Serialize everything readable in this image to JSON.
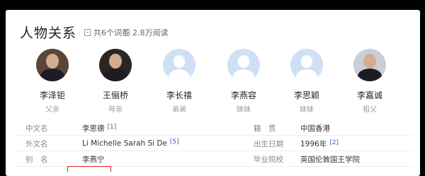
{
  "section": {
    "title": "人物关系",
    "term_count": "共6个词条",
    "read_count": "2.8万阅读"
  },
  "people": [
    {
      "name": "李泽钜",
      "relation": "父亲",
      "avatar": "photo"
    },
    {
      "name": "王俪桥",
      "relation": "母亲",
      "avatar": "photo"
    },
    {
      "name": "李长禧",
      "relation": "弟弟",
      "avatar": "placeholder"
    },
    {
      "name": "李燕容",
      "relation": "妹妹",
      "avatar": "placeholder"
    },
    {
      "name": "李思颖",
      "relation": "妹妹",
      "avatar": "placeholder"
    },
    {
      "name": "李嘉诚",
      "relation": "祖父",
      "avatar": "photo"
    }
  ],
  "info": {
    "rows": [
      {
        "label": "中文名",
        "value": "李思德",
        "ref": "[1]",
        "label2": "籍　贯",
        "value2": "中国香港",
        "ref2": ""
      },
      {
        "label": "外文名",
        "value": "Li Michelle Sarah Si De",
        "ref": "[5]",
        "label2": "出生日期",
        "value2": "1996年",
        "ref2": "[2]"
      },
      {
        "label": "别　名",
        "value": "李燕宁",
        "ref": "",
        "label2": "毕业院校",
        "value2": "英国伦敦国王学院",
        "ref2": ""
      }
    ]
  },
  "colors": {
    "background": "#000000",
    "card": "#ffffff",
    "link": "#3366cc",
    "placeholder_avatar": "#cfe0f6",
    "highlight_box": "#dd2222"
  }
}
